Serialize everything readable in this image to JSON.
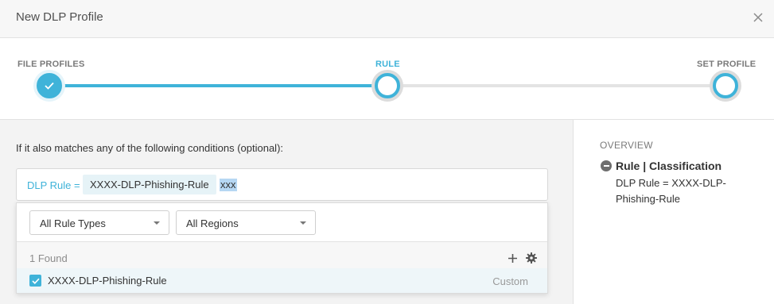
{
  "header": {
    "title": "New DLP Profile"
  },
  "stepper": {
    "steps": [
      {
        "label": "FILE PROFILES",
        "state": "done"
      },
      {
        "label": "RULE",
        "state": "current"
      },
      {
        "label": "SET PROFILE",
        "state": "pending"
      }
    ]
  },
  "main": {
    "conditions_label": "If it also matches any of the following conditions (optional):",
    "rule_input": {
      "prefix": "DLP Rule =",
      "chip": "XXXX-DLP-Phishing-Rule",
      "query": "xxx"
    },
    "dropdown": {
      "rule_type_select": "All Rule Types",
      "region_select": "All Regions",
      "found_text": "1 Found",
      "results": [
        {
          "name": "XXXX-DLP-Phishing-Rule",
          "type": "Custom",
          "checked": true
        }
      ]
    }
  },
  "overview": {
    "title": "OVERVIEW",
    "item_title": "Rule | Classification",
    "item_detail": "DLP Rule = XXXX-DLP-Phishing-Rule"
  },
  "colors": {
    "accent": "#3fb3d9",
    "chip_bg": "#e6f3f7",
    "selected_row": "#eef6f9"
  }
}
